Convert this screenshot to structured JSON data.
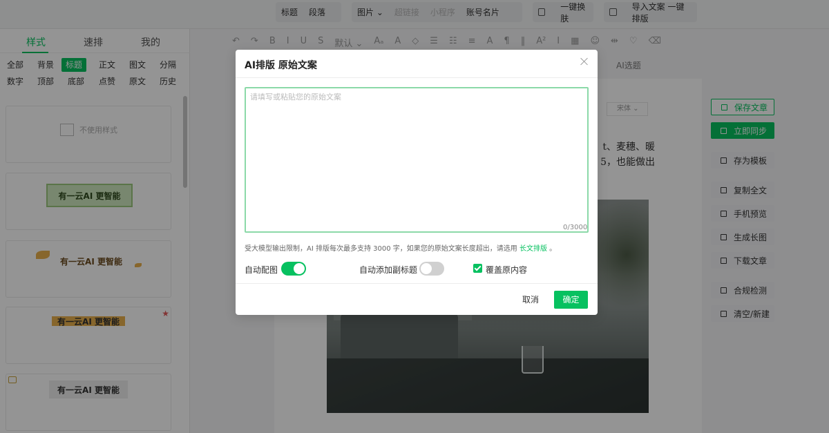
{
  "topbar": {
    "group1": [
      "标题",
      "段落"
    ],
    "group2_enabled": [
      "图片 ⌄"
    ],
    "group2_disabled": [
      "超链接",
      "小程序"
    ],
    "group2_end": "账号名片",
    "group3": "一键换肤",
    "group4": "导入文案 一键排版"
  },
  "left_panel": {
    "tabs": [
      "样式",
      "速排",
      "我的"
    ],
    "categories_row1": [
      "全部",
      "背景",
      "标题",
      "正文",
      "图文",
      "分隔"
    ],
    "categories_row2": [
      "数字",
      "顶部",
      "底部",
      "点赞",
      "原文",
      "历史"
    ],
    "no_style_label": "不使用样式",
    "style_sample_text": "有一云AI 更智能"
  },
  "editor": {
    "format_tools": [
      "↶",
      "↷",
      "B",
      "I",
      "U",
      "S",
      "默认 ⌄",
      "Aₐ",
      "A",
      "◇",
      "☰",
      "☷",
      "≡",
      "A",
      "¶",
      "‖",
      "A²",
      "I",
      "▦",
      "☺",
      "⇹",
      "♡",
      "⌫"
    ],
    "ai_pick_label": "AI选题",
    "font_select": "宋体 ⌄",
    "article_line1": "t、麦穗、暖",
    "article_line2": "5，也能做出"
  },
  "right_panel": {
    "save_label": "保存文章",
    "sync_label": "立即同步",
    "save_template_label": "存为模板",
    "copy_all_label": "复制全文",
    "mobile_preview_label": "手机预览",
    "long_image_label": "生成长图",
    "download_label": "下载文章",
    "compliance_label": "合规检测",
    "clear_label": "清空/新建"
  },
  "dialog": {
    "title": "AI排版 原始文案",
    "textarea_placeholder": "请填写或粘贴您的原始文案",
    "counter": "0/3000",
    "hint_text": "受大模型输出限制，AI 排版每次最多支持 3000 字，如果您的原始文案长度超出，请选用 ",
    "hint_link": "长文排版",
    "hint_end": " 。",
    "auto_image_label": "自动配图",
    "auto_subtitle_label": "自动添加副标题",
    "overwrite_label": "覆盖原内容",
    "cancel_label": "取消",
    "ok_label": "确定",
    "auto_image_on": true,
    "auto_subtitle_on": false,
    "overwrite_checked": true
  },
  "colors": {
    "accent": "#07c160",
    "overlay": "rgba(0,0,0,0.42)"
  }
}
